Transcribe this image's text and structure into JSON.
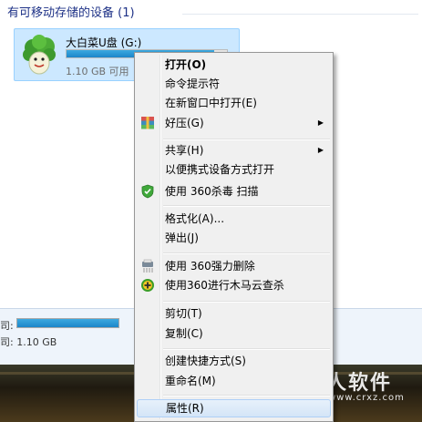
{
  "group_header": "有可移动存储的设备 (1)",
  "drive": {
    "name": "大白菜U盘 (G:)",
    "free_text": "1.10 GB 可用",
    "usage_fraction": 0.92
  },
  "details": {
    "label1": "司:",
    "label2": "司: 1.10 GB",
    "usage_fraction": 1.0
  },
  "context_menu": {
    "items": [
      {
        "label": "打开(O)",
        "bold": true
      },
      {
        "label": "命令提示符"
      },
      {
        "label": "在新窗口中打开(E)"
      },
      {
        "label": "好压(G)",
        "icon": "haozip-icon",
        "submenu": true
      },
      {
        "label": "共享(H)",
        "submenu": true
      },
      {
        "label": "以便携式设备方式打开"
      },
      {
        "label": "使用 360杀毒 扫描",
        "icon": "360-antivirus-shield-icon"
      },
      {
        "label": "格式化(A)..."
      },
      {
        "label": "弹出(J)"
      },
      {
        "label": "使用 360强力删除",
        "icon": "shredder-icon"
      },
      {
        "label": "使用360进行木马云查杀",
        "icon": "360-plus-icon"
      },
      {
        "label": "剪切(T)"
      },
      {
        "label": "复制(C)"
      },
      {
        "label": "创建快捷方式(S)"
      },
      {
        "label": "重命名(M)"
      },
      {
        "label": "属性(R)",
        "hover": true
      }
    ]
  },
  "watermark": {
    "text": "超人软件",
    "url": "www.crxz.com"
  },
  "colors": {
    "accent": "#1e3287",
    "tile_bg": "#cce8ff",
    "menu_bg": "#f0f0f0",
    "hover_border": "#aecff7",
    "bar_fill": "#1d86c9"
  }
}
